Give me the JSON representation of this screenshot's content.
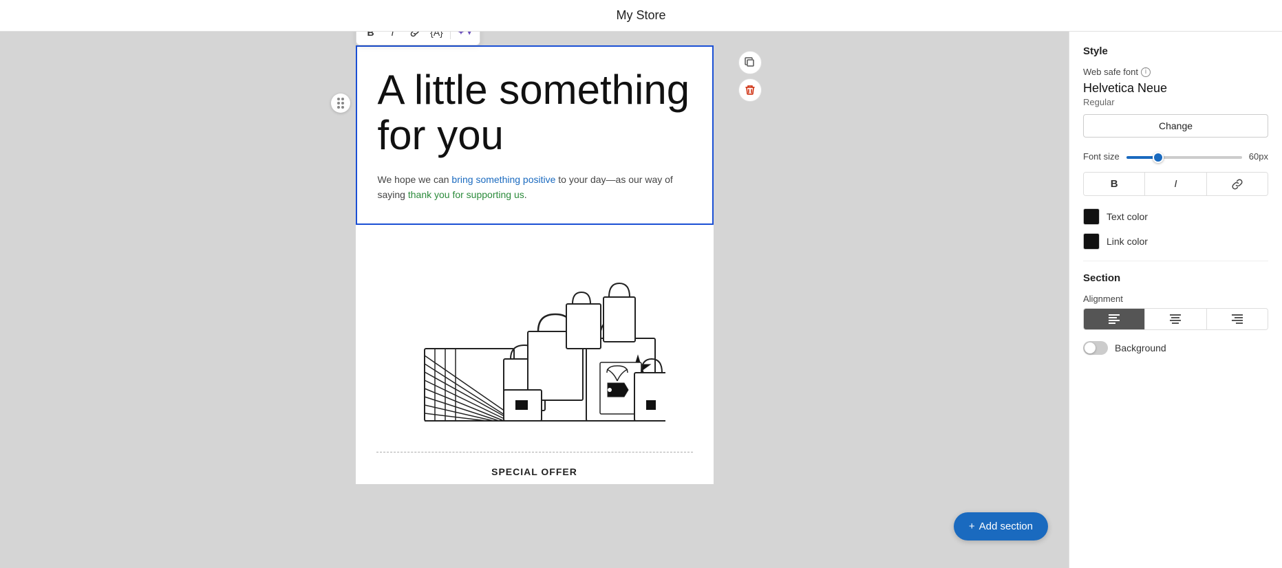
{
  "topbar": {
    "store_title": "My Store"
  },
  "toolbar": {
    "bold_label": "B",
    "italic_label": "I",
    "link_label": "🔗",
    "variable_label": "{A}",
    "ai_label": "✦",
    "ai_dropdown": "▾"
  },
  "canvas": {
    "headline": "A little something for you",
    "subtext": "We hope we can bring something positive to your day—as our way of saying thank you for supporting us.",
    "divider_text": "SPECIAL OFFER"
  },
  "block_actions": {
    "copy_icon": "⊡",
    "delete_icon": "🗑"
  },
  "add_section": {
    "label": "+ Add section"
  },
  "right_panel": {
    "style_title": "Style",
    "font_label": "Web safe font",
    "font_name": "Helvetica Neue",
    "font_style": "Regular",
    "change_btn": "Change",
    "font_size_label": "Font size",
    "font_size_value": "60px",
    "font_size_slider": 25,
    "bold_btn": "B",
    "italic_btn": "I",
    "link_btn": "🔗",
    "text_color_label": "Text color",
    "link_color_label": "Link color",
    "text_color": "#111111",
    "link_color": "#111111",
    "section_title": "Section",
    "alignment_label": "Alignment",
    "background_label": "Background",
    "alignment_options": [
      "left",
      "center",
      "right"
    ],
    "alignment_active": "left"
  }
}
